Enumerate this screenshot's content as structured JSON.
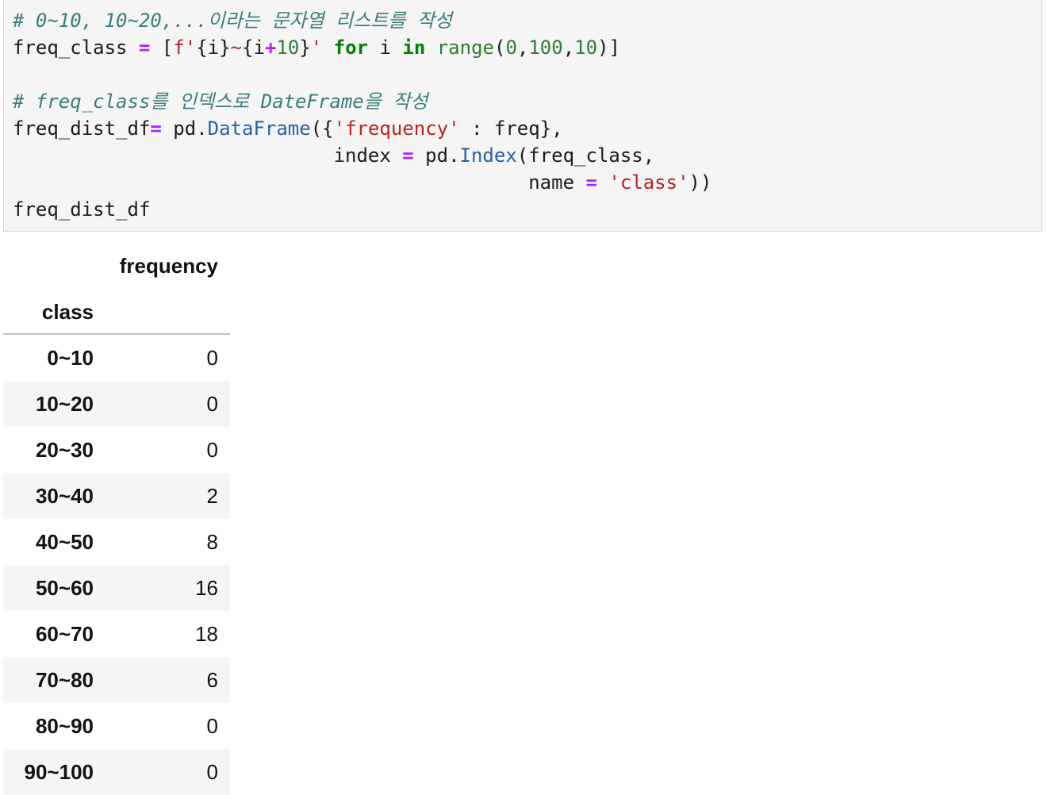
{
  "code_cell": {
    "lines": [
      [
        {
          "t": "cm",
          "v": "# 0~10, 10~20,...이라는 문자열 리스트를 작성"
        }
      ],
      [
        {
          "t": "tx",
          "v": "freq_class "
        },
        {
          "t": "op",
          "v": "="
        },
        {
          "t": "tx",
          "v": " ["
        },
        {
          "t": "st",
          "v": "f'"
        },
        {
          "t": "tx",
          "v": "{i}"
        },
        {
          "t": "st",
          "v": "~"
        },
        {
          "t": "tx",
          "v": "{i"
        },
        {
          "t": "op",
          "v": "+"
        },
        {
          "t": "nm",
          "v": "10"
        },
        {
          "t": "tx",
          "v": "}"
        },
        {
          "t": "st",
          "v": "'"
        },
        {
          "t": "tx",
          "v": " "
        },
        {
          "t": "kw",
          "v": "for"
        },
        {
          "t": "tx",
          "v": " i "
        },
        {
          "t": "kw",
          "v": "in"
        },
        {
          "t": "tx",
          "v": " "
        },
        {
          "t": "nm",
          "v": "range"
        },
        {
          "t": "tx",
          "v": "("
        },
        {
          "t": "nm",
          "v": "0"
        },
        {
          "t": "tx",
          "v": ","
        },
        {
          "t": "nm",
          "v": "100"
        },
        {
          "t": "tx",
          "v": ","
        },
        {
          "t": "nm",
          "v": "10"
        },
        {
          "t": "tx",
          "v": ")]"
        }
      ],
      [],
      [
        {
          "t": "cm",
          "v": "# freq_class를 인덱스로 DateFrame을 작성"
        }
      ],
      [
        {
          "t": "tx",
          "v": "freq_dist_df"
        },
        {
          "t": "op",
          "v": "="
        },
        {
          "t": "tx",
          "v": " pd."
        },
        {
          "t": "fn",
          "v": "DataFrame"
        },
        {
          "t": "tx",
          "v": "({"
        },
        {
          "t": "st",
          "v": "'frequency'"
        },
        {
          "t": "tx",
          "v": " : freq},"
        }
      ],
      [
        {
          "t": "tx",
          "v": "                            index "
        },
        {
          "t": "op",
          "v": "="
        },
        {
          "t": "tx",
          "v": " pd."
        },
        {
          "t": "fn",
          "v": "Index"
        },
        {
          "t": "tx",
          "v": "(freq_class,"
        }
      ],
      [
        {
          "t": "tx",
          "v": "                                             name "
        },
        {
          "t": "op",
          "v": "="
        },
        {
          "t": "tx",
          "v": " "
        },
        {
          "t": "st",
          "v": "'class'"
        },
        {
          "t": "tx",
          "v": "))"
        }
      ],
      [
        {
          "t": "tx",
          "v": "freq_dist_df"
        }
      ]
    ]
  },
  "colors": {
    "comment": "#3a7d7c",
    "keyword": "#008000",
    "operator": "#aa22ff",
    "string": "#ba2121",
    "number": "#2e7d32",
    "function": "#2a5ea8",
    "cell_background": "#f5f5f5",
    "row_stripe": "#f5f5f5"
  },
  "table": {
    "column_header": "frequency",
    "index_name": "class",
    "rows": [
      {
        "index": "0~10",
        "frequency": "0"
      },
      {
        "index": "10~20",
        "frequency": "0"
      },
      {
        "index": "20~30",
        "frequency": "0"
      },
      {
        "index": "30~40",
        "frequency": "2"
      },
      {
        "index": "40~50",
        "frequency": "8"
      },
      {
        "index": "50~60",
        "frequency": "16"
      },
      {
        "index": "60~70",
        "frequency": "18"
      },
      {
        "index": "70~80",
        "frequency": "6"
      },
      {
        "index": "80~90",
        "frequency": "0"
      },
      {
        "index": "90~100",
        "frequency": "0"
      }
    ]
  }
}
